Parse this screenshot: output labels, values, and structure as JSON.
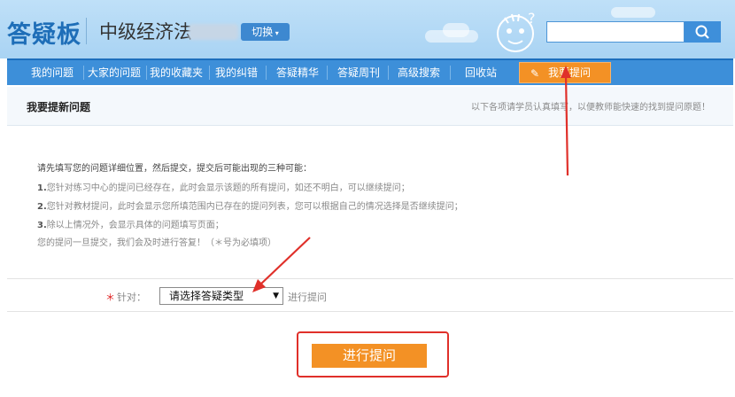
{
  "header": {
    "logo": "答疑板",
    "subject": "中级经济法",
    "switch_label": "切换"
  },
  "search": {
    "placeholder": "",
    "button_icon": "search-icon"
  },
  "nav": {
    "items": [
      "我的问题",
      "大家的问题",
      "我的收藏夹",
      "我的纠错",
      "答疑精华",
      "答疑周刊",
      "高级搜索",
      "回收站"
    ],
    "active_label": "我要提问",
    "active_icon": "pencil-icon"
  },
  "section": {
    "title": "我要提新问题",
    "hint": "以下各项请学员认真填写，以便教师能快速的找到提问原题！"
  },
  "instructions": {
    "intro": "请先填写您的问题详细位置，然后提交，提交后可能出现的三种可能：",
    "items": [
      {
        "num": "1.",
        "text": "您针对练习中心的提问已经存在，此时会显示该题的所有提问，如还不明白，可以继续提问；"
      },
      {
        "num": "2.",
        "text": "您针对教材提问，此时会显示您所填范围内已存在的提问列表，您可以根据自己的情况选择是否继续提问；"
      },
      {
        "num": "3.",
        "text": "除以上情况外，会显示具体的问题填写页面；"
      }
    ],
    "closing": "您的提问一旦提交，我们会及时进行答复！（＊号为必填项）"
  },
  "form": {
    "required_mark": "＊",
    "label": "针对：",
    "select_value": "请选择答疑类型",
    "suffix": "进行提问"
  },
  "submit_label": "进行提问",
  "colors": {
    "accent_orange": "#f39125",
    "nav_blue": "#3d8fd9",
    "annotation_red": "#e0302a"
  }
}
